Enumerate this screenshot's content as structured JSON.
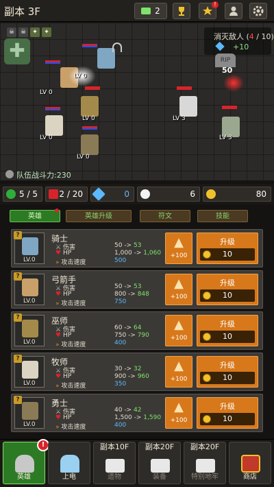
{
  "header": {
    "floor_title": "副本 3F",
    "video_count": "2",
    "icons": [
      "video-icon",
      "trophy-icon",
      "quest-icon",
      "profile-icon",
      "gear-icon"
    ]
  },
  "battle": {
    "kill_label_prefix": "消灭敌人 (",
    "kills": "4",
    "kill_target": " / 10)",
    "kill_reward": "+10",
    "team_power_label": "队伍战斗力",
    "team_power_value": ":230",
    "unit_levels": [
      "LV 0",
      "LV 0",
      "LV 0",
      "LV 0",
      "LV 0",
      "LV 3",
      "LV 3"
    ],
    "damage_popup": "50",
    "tombstone": "RIP"
  },
  "resources": {
    "team": "5 / 5",
    "potion": "2 / 20",
    "gems": "0",
    "skulls": "6",
    "gold": "80"
  },
  "tabs": [
    "英雄",
    "英雄升级",
    "符文",
    "技能"
  ],
  "stat_labels": {
    "damage": "伤害",
    "hp": "HP",
    "speed": "攻击速度"
  },
  "upgrade_label": "升级",
  "plus_label": "+100",
  "heroes": [
    {
      "name": "骑士",
      "level": "LV.0",
      "damage": "50 -> ",
      "damage_next": "53",
      "hp": "1,000 -> ",
      "hp_next": "1,060",
      "speed": "500",
      "cost": "10"
    },
    {
      "name": "弓箭手",
      "level": "LV.0",
      "damage": "50 -> ",
      "damage_next": "53",
      "hp": "800 -> ",
      "hp_next": "848",
      "speed": "750",
      "cost": "10"
    },
    {
      "name": "巫师",
      "level": "LV.0",
      "damage": "60 -> ",
      "damage_next": "64",
      "hp": "750 -> ",
      "hp_next": "790",
      "speed": "400",
      "cost": "10"
    },
    {
      "name": "牧师",
      "level": "LV.0",
      "damage": "30 -> ",
      "damage_next": "32",
      "hp": "900 -> ",
      "hp_next": "960",
      "speed": "350",
      "cost": "10"
    },
    {
      "name": "勇士",
      "level": "LV.0",
      "damage": "40 -> ",
      "damage_next": "42",
      "hp": "1,500 -> ",
      "hp_next": "1,590",
      "speed": "400",
      "cost": "10"
    }
  ],
  "nav": [
    {
      "label": "英雄",
      "floor": ""
    },
    {
      "label": "上电",
      "floor": ""
    },
    {
      "label": "遗物",
      "floor": "副本10F"
    },
    {
      "label": "装备",
      "floor": "副本20F"
    },
    {
      "label": "特别地牢",
      "floor": "副本20F"
    },
    {
      "label": "商店",
      "floor": ""
    }
  ],
  "colors": {
    "accent_orange": "#d7781b",
    "green_text": "#7ee36a",
    "blue_text": "#5cb8ff",
    "alert_red": "#d9232a"
  }
}
